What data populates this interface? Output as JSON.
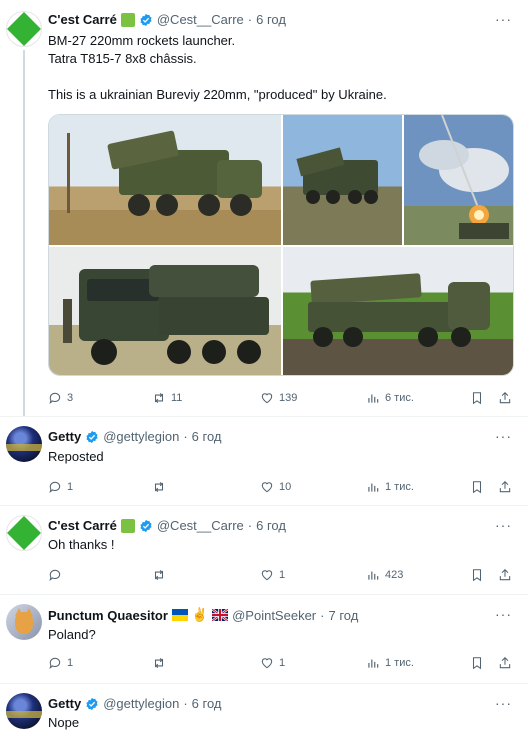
{
  "posts": [
    {
      "name": "C'est Carré",
      "handle": "@Cest__Carre",
      "dot": "·",
      "time": "6 год",
      "lines": [
        "BM-27 220mm rockets launcher.",
        "Tatra T815-7 8x8 châssis.",
        "",
        "This is a ukrainian Bureviy 220mm, \"produced\" by Ukraine."
      ],
      "reply_count": "3",
      "repost_count": "11",
      "like_count": "139",
      "views": "6 тис."
    },
    {
      "name": "Getty",
      "handle": "@gettylegion",
      "dot": "·",
      "time": "6 год",
      "lines": [
        "Reposted"
      ],
      "reply_count": "1",
      "repost_count": "",
      "like_count": "10",
      "views": "1 тис."
    },
    {
      "name": "C'est Carré",
      "handle": "@Cest__Carre",
      "dot": "·",
      "time": "6 год",
      "lines": [
        "Oh thanks !"
      ],
      "reply_count": "",
      "repost_count": "",
      "like_count": "1",
      "views": "423"
    },
    {
      "name": "Punctum Quaesitor",
      "name_emoji": "✌",
      "handle": "@PointSeeker",
      "dot": "·",
      "time": "7 год",
      "lines": [
        "Poland?"
      ],
      "reply_count": "1",
      "repost_count": "",
      "like_count": "1",
      "views": "1 тис."
    },
    {
      "name": "Getty",
      "handle": "@gettylegion",
      "dot": "·",
      "time": "6 год",
      "lines": [
        "Nope"
      ]
    }
  ],
  "more_label": "···",
  "colors": {
    "accent": "#1d9bf0",
    "text": "#0f1419",
    "muted": "#536471",
    "divider": "#eff3f4"
  }
}
